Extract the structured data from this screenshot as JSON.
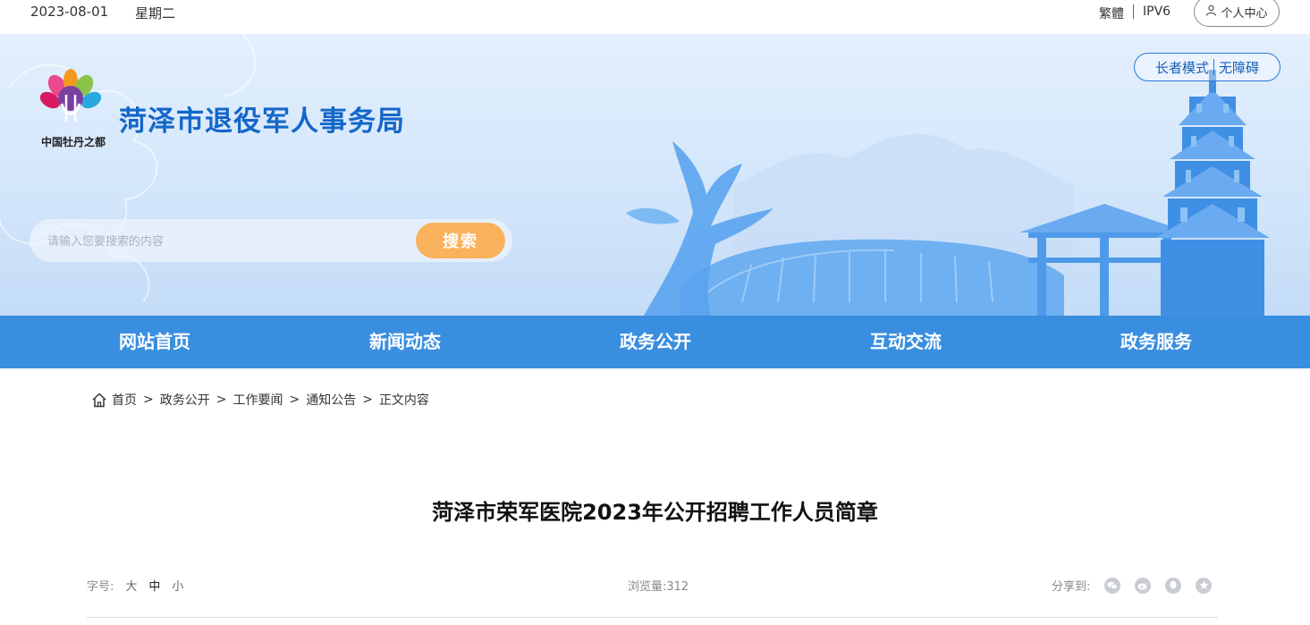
{
  "topbar": {
    "date": "2023-08-01",
    "weekday": "星期二",
    "traditional_label": "繁體",
    "ipv6_label": "IPV6",
    "user_center_label": "个人中心"
  },
  "header": {
    "logo_text": "中国牡丹之都",
    "title": "菏泽市退役军人事务局",
    "elder_mode_label": "长者模式",
    "accessibility_label": "无障碍"
  },
  "search": {
    "placeholder": "请输入您要搜索的内容",
    "button_label": "搜索"
  },
  "nav": {
    "items": [
      {
        "label": "网站首页"
      },
      {
        "label": "新闻动态"
      },
      {
        "label": "政务公开"
      },
      {
        "label": "互动交流"
      },
      {
        "label": "政务服务"
      }
    ]
  },
  "breadcrumb": {
    "items": [
      "首页",
      "政务公开",
      "工作要闻",
      "通知公告",
      "正文内容"
    ],
    "separator": ">"
  },
  "article": {
    "title": "菏泽市荣军医院2023年公开招聘工作人员简章",
    "font_size_label": "字号:",
    "font_size_options": [
      "大",
      "中",
      "小"
    ],
    "views_label": "浏览量:",
    "views_count": "312",
    "share_label": "分享到:",
    "share_icons": [
      "wechat-icon",
      "weibo-icon",
      "qq-icon",
      "qzone-icon"
    ]
  },
  "colors": {
    "brand_blue": "#1467c9",
    "nav_blue": "#3a8ee0",
    "search_orange": "#fbb25c"
  }
}
